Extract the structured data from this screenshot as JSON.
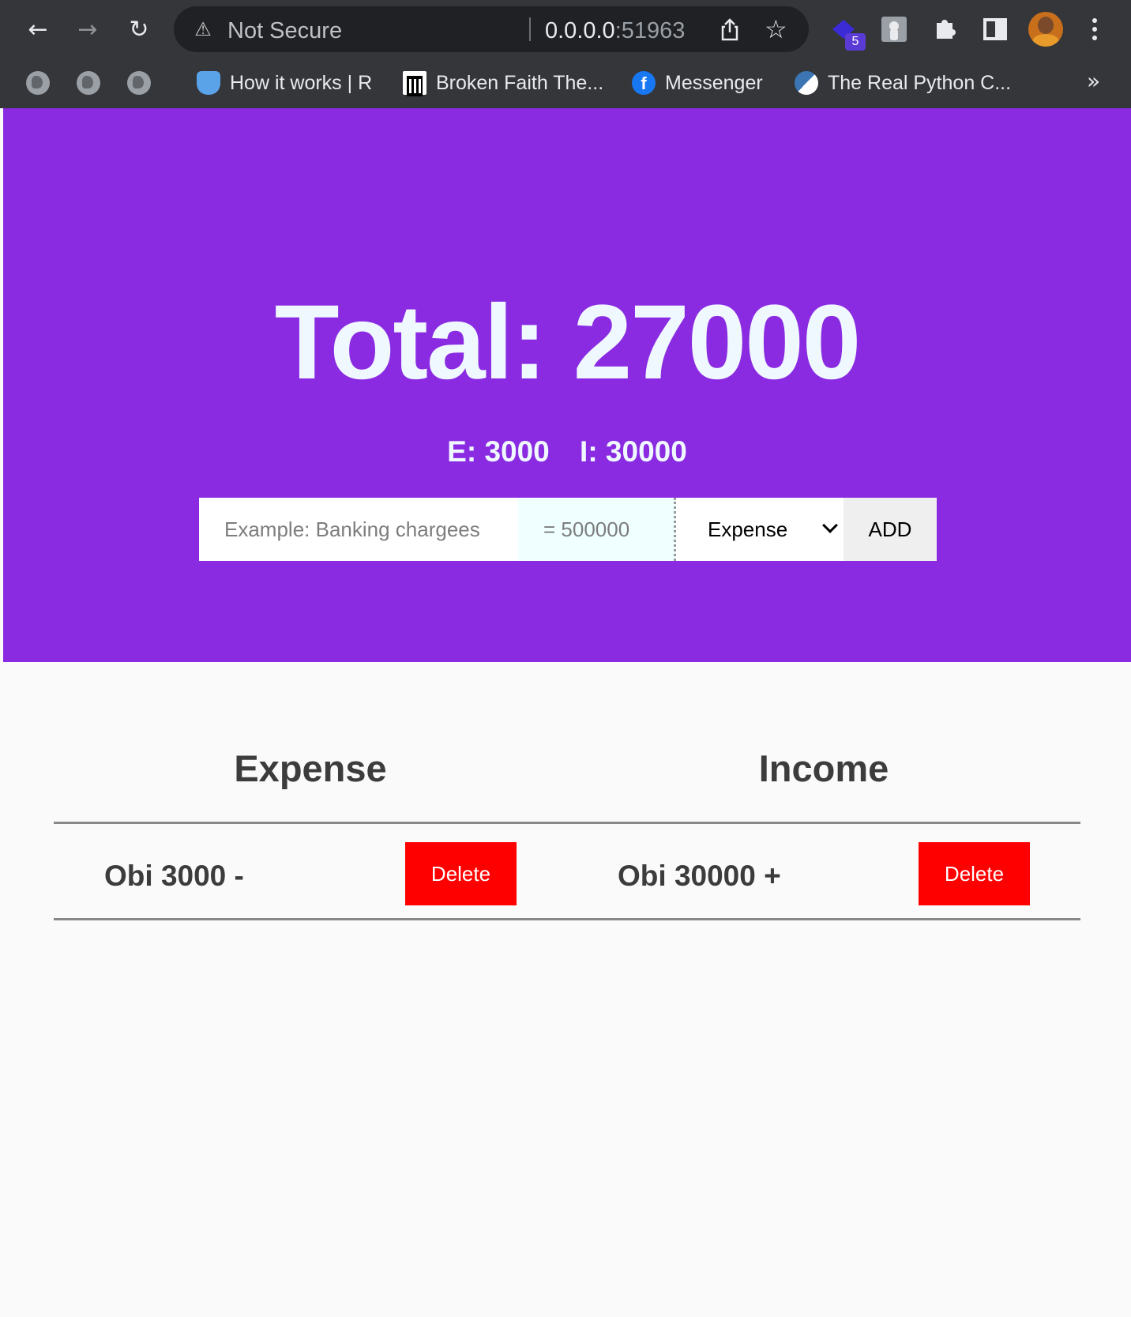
{
  "browser": {
    "security_label": "Not Secure",
    "url_host": "0.0.0.0",
    "url_port": ":51963",
    "extension_badge": "5",
    "bookmarks": [
      {
        "label": "How it works | R"
      },
      {
        "label": "Broken Faith The..."
      },
      {
        "label": "Messenger"
      },
      {
        "label": "The Real Python C..."
      }
    ],
    "more_bookmarks": "»"
  },
  "app": {
    "total_label": "Total: 27000",
    "expense_summary": "E: 3000",
    "income_summary": "I: 30000",
    "form": {
      "description_placeholder": "Example: Banking chargees",
      "amount_placeholder": "= 500000",
      "type_selected": "Expense",
      "add_label": "ADD"
    },
    "expense": {
      "heading": "Expense",
      "items": [
        {
          "label": "Obi 3000 -",
          "delete_label": "Delete"
        }
      ]
    },
    "income": {
      "heading": "Income",
      "items": [
        {
          "label": "Obi 30000 +",
          "delete_label": "Delete"
        }
      ]
    },
    "colors": {
      "hero": "#8a2be2",
      "delete": "#ff0000",
      "hero_text": "#f0f8ff"
    }
  }
}
